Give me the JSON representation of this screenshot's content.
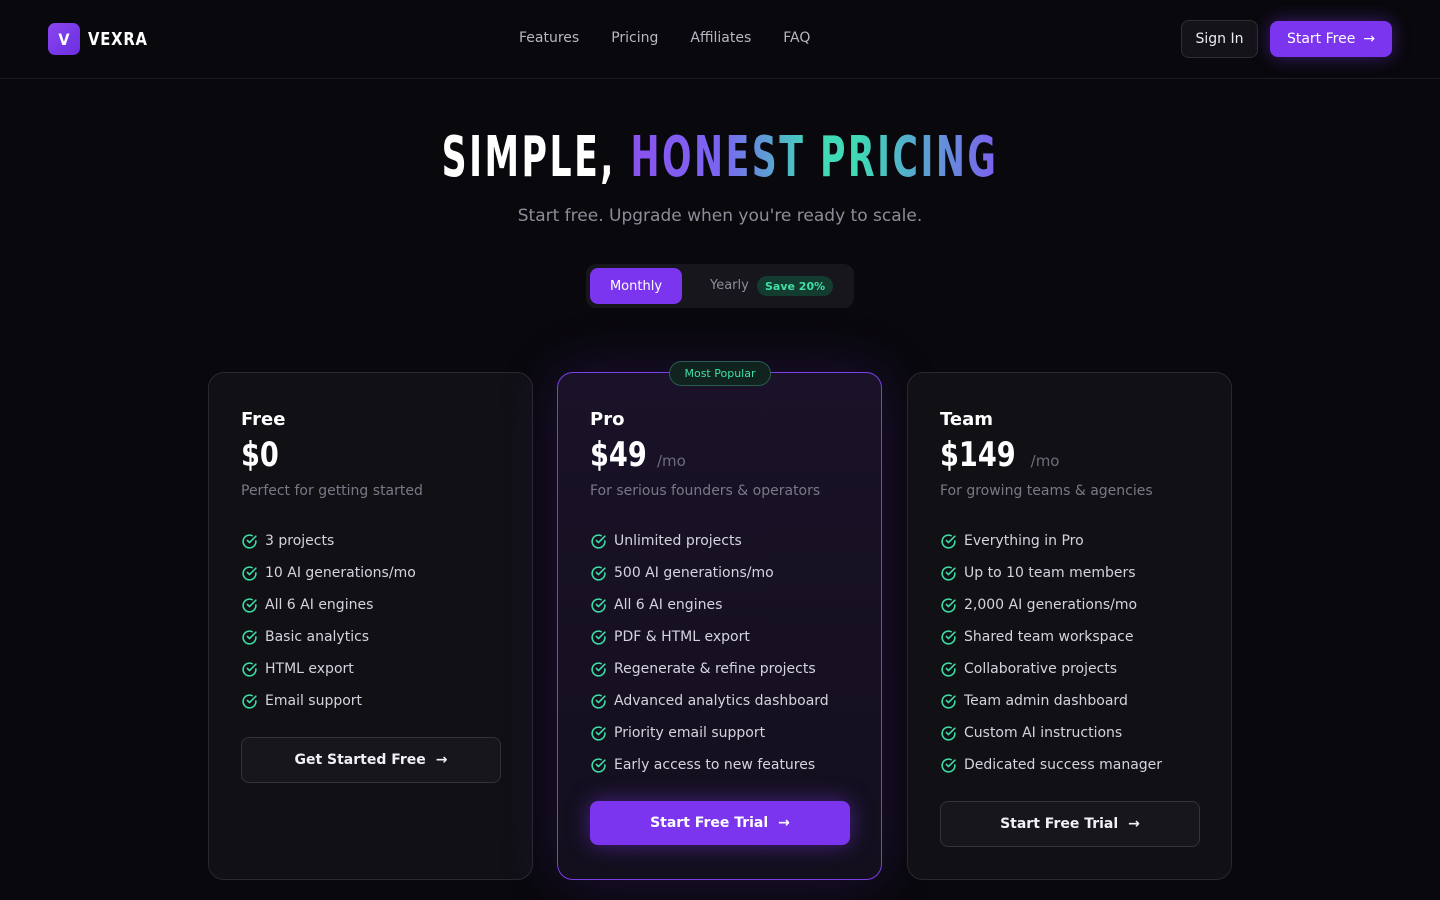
{
  "brand": {
    "mark": "V",
    "name": "VEXRA"
  },
  "nav": {
    "links": [
      "Features",
      "Pricing",
      "Affiliates",
      "FAQ"
    ],
    "sign_in": "Sign In",
    "start_free": "Start Free"
  },
  "hero": {
    "title_part1": "SIMPLE,",
    "title_part2": "HONEST PRICING",
    "subtitle": "Start free. Upgrade when you're ready to scale."
  },
  "billing_toggle": {
    "monthly": "Monthly",
    "yearly": "Yearly",
    "save_badge": "Save 20%",
    "selected": "Monthly"
  },
  "plans": [
    {
      "name": "Free",
      "price": "$0",
      "period": "",
      "description": "Perfect for getting started",
      "features": [
        "3 projects",
        "10 AI generations/mo",
        "All 6 AI engines",
        "Basic analytics",
        "HTML export",
        "Email support"
      ],
      "cta": "Get Started Free"
    },
    {
      "name": "Pro",
      "badge": "Most Popular",
      "price": "$49",
      "period": "/mo",
      "description": "For serious founders & operators",
      "features": [
        "Unlimited projects",
        "500 AI generations/mo",
        "All 6 AI engines",
        "PDF & HTML export",
        "Regenerate & refine projects",
        "Advanced analytics dashboard",
        "Priority email support",
        "Early access to new features"
      ],
      "cta": "Start Free Trial"
    },
    {
      "name": "Team",
      "price": "$149",
      "period": "/mo",
      "description": "For growing teams & agencies",
      "features": [
        "Everything in Pro",
        "Up to 10 team members",
        "2,000 AI generations/mo",
        "Shared team workspace",
        "Collaborative projects",
        "Team admin dashboard",
        "Custom AI instructions",
        "Dedicated success manager"
      ],
      "cta": "Start Free Trial"
    }
  ],
  "colors": {
    "background": "#09080c",
    "accent": "#7b35ee",
    "check": "#3ee0a5"
  },
  "icons": {
    "check": "check-circle-icon",
    "arrow": "arrow-right-icon"
  }
}
